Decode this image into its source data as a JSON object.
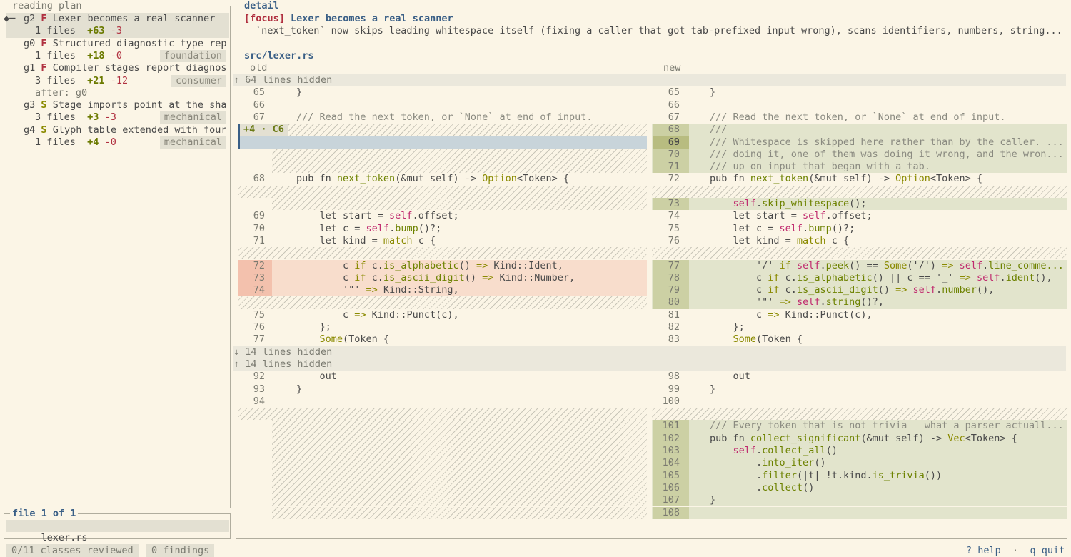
{
  "plan": {
    "title": "reading plan",
    "items": [
      {
        "id": "g2",
        "kind": "F",
        "title": "Lexer becomes a real scanner",
        "files": "1 files",
        "add": "+63",
        "del": "-3",
        "tag": "",
        "selected": true
      },
      {
        "id": "g0",
        "kind": "F",
        "title": "Structured diagnostic type rep",
        "files": "1 files",
        "add": "+18",
        "del": "-0",
        "tag": "foundation"
      },
      {
        "id": "g1",
        "kind": "F",
        "title": "Compiler stages report diagnos",
        "files": "3 files",
        "add": "+21",
        "del": "-12",
        "tag": "consumer",
        "after": "after: g0"
      },
      {
        "id": "g3",
        "kind": "S",
        "title": "Stage imports point at the sha",
        "files": "3 files",
        "add": "+3",
        "del": "-3",
        "tag": "mechanical"
      },
      {
        "id": "g4",
        "kind": "S",
        "title": "Glyph table extended with four",
        "files": "1 files",
        "add": "+4",
        "del": "-0",
        "tag": "mechanical"
      }
    ]
  },
  "files": {
    "title": "file 1 of 1",
    "items": [
      "lexer.rs"
    ]
  },
  "detail": {
    "title": "detail",
    "focus_label": "[focus]",
    "focus_title": "Lexer becomes a real scanner",
    "description": "`next_token` now skips leading whitespace itself (fixing a caller that got tab-prefixed input wrong), scans identifiers, numbers, string...",
    "file_path": "src/lexer.rs",
    "old_label": "old",
    "new_label": "new",
    "hunk_badge": "+4 · C6",
    "hidden_top": "64 lines hidden",
    "hidden_mid_down": "14 lines hidden",
    "hidden_mid_up": "14 lines hidden",
    "hidden_up_arrow": "↑",
    "hidden_down_arrow": "↓"
  },
  "status": {
    "reviewed": "0/11 classes reviewed",
    "findings": "0 findings",
    "help": "? help",
    "sep": "·",
    "quit": "q quit"
  },
  "colors": {
    "accent": "#3a5f86",
    "removed": "#b03040",
    "added": "#6b7a00",
    "added_bg": "#e2e4cc",
    "removed_bg": "#f8ddcc"
  }
}
